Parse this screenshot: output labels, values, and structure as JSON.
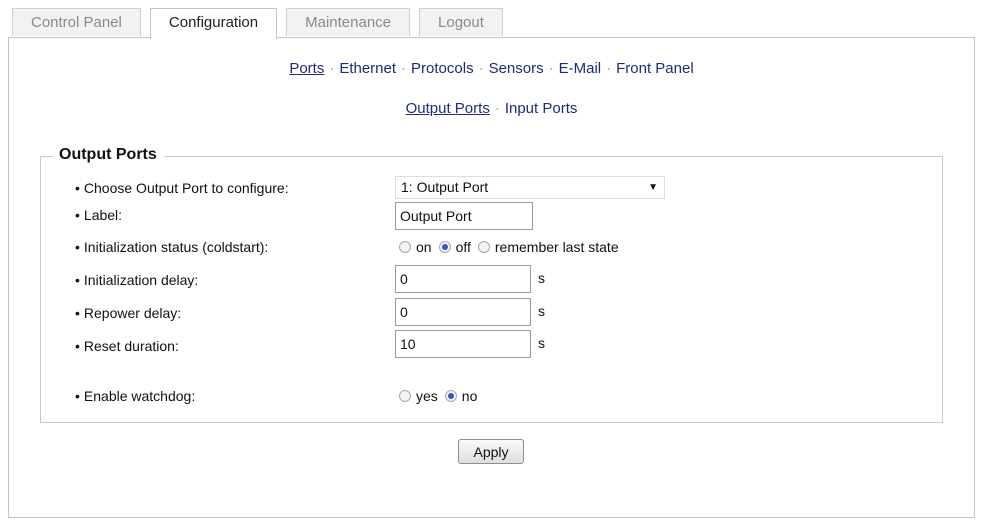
{
  "tabs": [
    {
      "label": "Control Panel"
    },
    {
      "label": "Configuration"
    },
    {
      "label": "Maintenance"
    },
    {
      "label": "Logout"
    }
  ],
  "nav": {
    "primary": [
      "Ports",
      "Ethernet",
      "Protocols",
      "Sensors",
      "E-Mail",
      "Front Panel"
    ],
    "secondary": [
      "Output Ports",
      "Input Ports"
    ],
    "separator": "·"
  },
  "form": {
    "legend": "Output Ports",
    "bullet": "•",
    "choose_label": "Choose Output Port to configure:",
    "choose_value": "1: Output Port",
    "label_label": "Label:",
    "label_value": "Output Port",
    "init_status_label": "Initialization status (coldstart):",
    "init_status_options": [
      "on",
      "off",
      "remember last state"
    ],
    "init_status_selected": "off",
    "init_delay_label": "Initialization delay:",
    "init_delay_value": "0",
    "repower_label": "Repower delay:",
    "repower_value": "0",
    "reset_label": "Reset duration:",
    "reset_value": "10",
    "unit": "s",
    "watchdog_label": "Enable watchdog:",
    "watchdog_options": [
      "yes",
      "no"
    ],
    "watchdog_selected": "no"
  },
  "apply_label": "Apply",
  "colors": {
    "link": "#1f2a7a",
    "radio_dot": "#3a52c4"
  }
}
